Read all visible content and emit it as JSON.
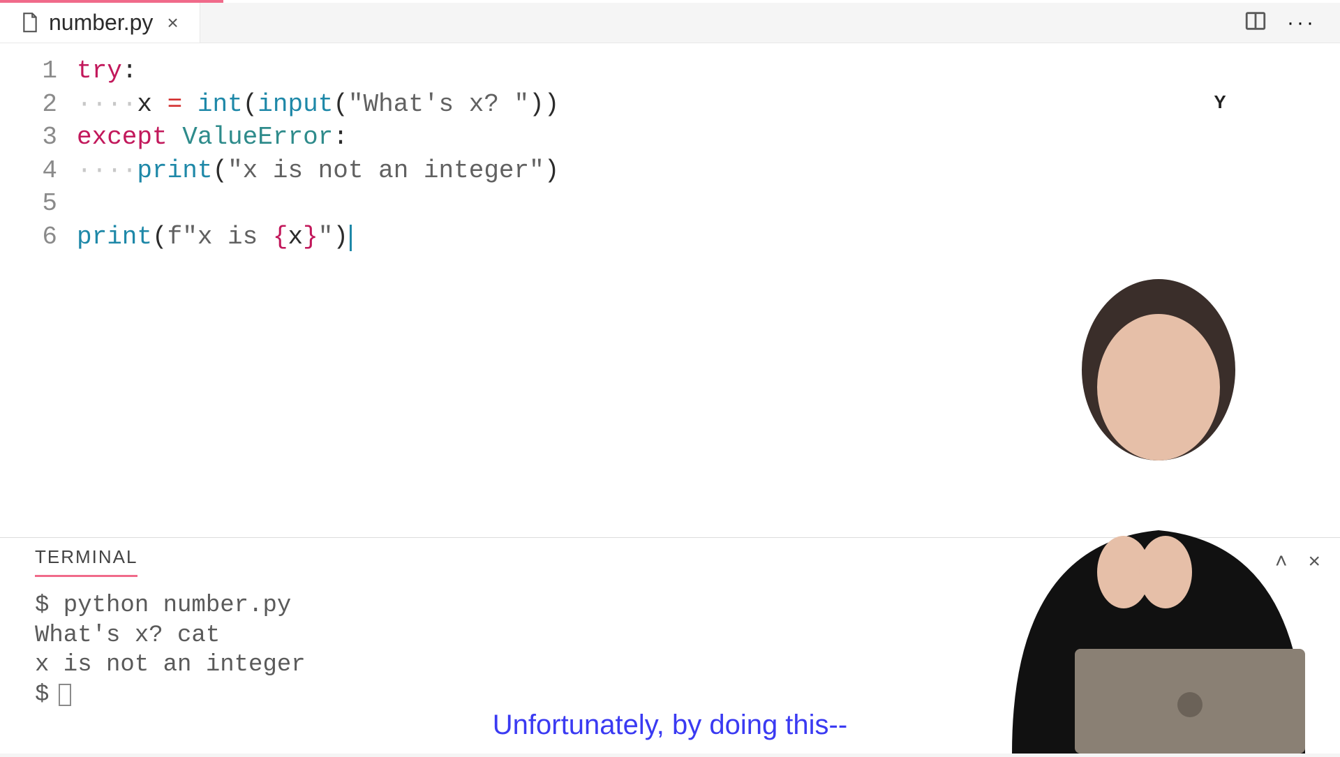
{
  "tab": {
    "filename": "number.py",
    "close_glyph": "×"
  },
  "editor": {
    "lines": [
      {
        "n": "1",
        "seg": [
          {
            "c": "tok-kw",
            "t": "try"
          },
          {
            "c": "",
            "t": ":"
          }
        ]
      },
      {
        "n": "2",
        "seg": [
          {
            "c": "tok-ws",
            "t": "····"
          },
          {
            "c": "",
            "t": "x "
          },
          {
            "c": "tok-op",
            "t": "="
          },
          {
            "c": "",
            "t": " "
          },
          {
            "c": "tok-fn",
            "t": "int"
          },
          {
            "c": "",
            "t": "("
          },
          {
            "c": "tok-fn",
            "t": "input"
          },
          {
            "c": "",
            "t": "("
          },
          {
            "c": "tok-str",
            "t": "\"What's x? \""
          },
          {
            "c": "",
            "t": "))"
          }
        ]
      },
      {
        "n": "3",
        "seg": [
          {
            "c": "tok-kw",
            "t": "except"
          },
          {
            "c": "",
            "t": " "
          },
          {
            "c": "tok-cls",
            "t": "ValueError"
          },
          {
            "c": "",
            "t": ":"
          }
        ]
      },
      {
        "n": "4",
        "seg": [
          {
            "c": "tok-ws",
            "t": "····"
          },
          {
            "c": "tok-fn",
            "t": "print"
          },
          {
            "c": "",
            "t": "("
          },
          {
            "c": "tok-str",
            "t": "\"x is not an integer\""
          },
          {
            "c": "",
            "t": ")"
          }
        ]
      },
      {
        "n": "5",
        "seg": []
      },
      {
        "n": "6",
        "seg": [
          {
            "c": "tok-fn",
            "t": "print"
          },
          {
            "c": "",
            "t": "("
          },
          {
            "c": "tok-str",
            "t": "f\"x is "
          },
          {
            "c": "tok-brc",
            "t": "{"
          },
          {
            "c": "",
            "t": "x"
          },
          {
            "c": "tok-brc",
            "t": "}"
          },
          {
            "c": "tok-str",
            "t": "\""
          },
          {
            "c": "",
            "t": ")"
          }
        ],
        "cursor": true
      }
    ]
  },
  "badge": {
    "glyph": "Y"
  },
  "terminal": {
    "tab_label": "TERMINAL",
    "chevron": "˄",
    "close": "×",
    "lines": [
      "$ python number.py",
      "What's x? cat",
      "x is not an integer"
    ],
    "prompt": "$"
  },
  "caption": "Unfortunately, by doing this--"
}
